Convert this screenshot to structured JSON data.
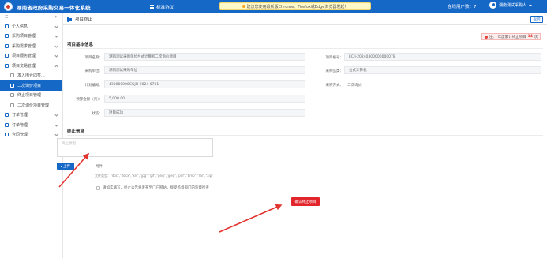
{
  "header": {
    "app_title": "湖南省政府采购交易一体化系统",
    "menu_label": "标准协议",
    "notice": "建议您使用最新版Chrome、Firefox或Edge浏览器发起！",
    "online_users": "在线用户数：7",
    "user_name": "湖南测试采购人"
  },
  "sidebar": {
    "items": [
      {
        "label": "个人信息"
      },
      {
        "label": "采购项目管理"
      },
      {
        "label": "采购需求管理"
      },
      {
        "label": "项目服务管理"
      },
      {
        "label": "项目交易管理"
      },
      {
        "label": "发入围合同签..."
      },
      {
        "label": "二次询价项目"
      },
      {
        "label": "终止项目管理"
      },
      {
        "label": "二次询价项目管理"
      },
      {
        "label": "订单管理"
      },
      {
        "label": "订单管理"
      },
      {
        "label": "合同管理"
      }
    ]
  },
  "tab": {
    "title": "项目终止",
    "back_label": "返回"
  },
  "deadline": {
    "prefix": "注：",
    "text": "年度累计终止项目",
    "count": "14",
    "unit": "次"
  },
  "basic": {
    "section_title": "项目基本信息",
    "project_name_label": "项目名称：",
    "project_name": "湖南测试采购单位台式计算机二次询价项目",
    "project_no_label": "项目编号：",
    "project_no": "ECJJ-20240300000000078",
    "purchase_unit_label": "采购单位：",
    "purchase_unit": "湖南测试采购单位",
    "category_label": "采购品类：",
    "category": "台式计算机",
    "plan_no_label": "计划编号：",
    "plan_no": "430000000CGJH-2024-0701",
    "method_label": "采购方式：",
    "method": "二次询价",
    "budget_label": "预算金额（元）：",
    "budget": "5,000.00",
    "status_label": "状态：",
    "status": "项目成功"
  },
  "terminate": {
    "section_title": "终止信息",
    "reason_label": "终止原因",
    "reason_placeholder": "终止原因",
    "attachment_label": "附件",
    "upload_label": "上传",
    "file_types": "文件类型：\"doc\",\"docx\",\"xls\",\"jpg\",\"gif\",\"png\",\"jpeg\",\"pdf\",\"bmp\",\"rar\",\"zip\"",
    "agree_text": "请如实填写，终止公告将发布至门户网站，接受监督部门的监督检查",
    "submit_label": "确认终止项目"
  },
  "colors": {
    "primary": "#1668c7",
    "danger": "#e1252b",
    "arrow": "#e2342f"
  }
}
